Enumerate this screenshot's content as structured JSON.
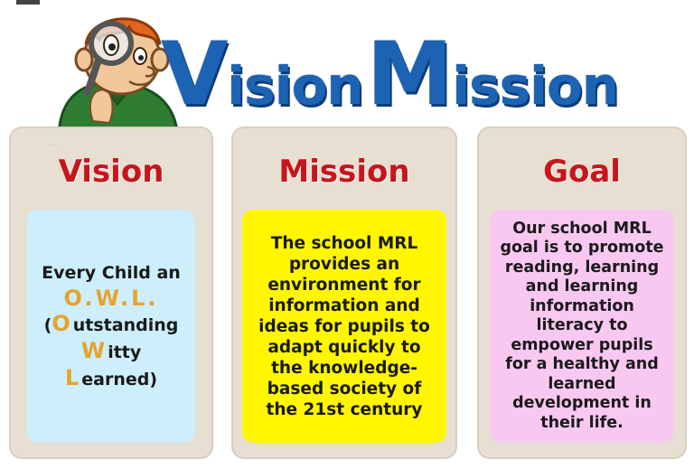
{
  "banner": {
    "title_part1_initial": "V",
    "title_part1_rest": "ision",
    "title_part2_initial": "M",
    "title_part2_rest": "ission"
  },
  "panels": {
    "vision": {
      "heading": "Vision",
      "line1": "Every Child an",
      "owl": "O.W.L.",
      "paren_open": "(",
      "o_letter": "O",
      "o_rest": "utstanding",
      "w_letter": "W",
      "w_rest": "itty",
      "l_letter": "L",
      "l_rest": "earned)"
    },
    "mission": {
      "heading": "Mission",
      "body": "The school MRL provides an environment for information and ideas for pupils to adapt quickly to the knowledge-based society of the 21st century"
    },
    "goal": {
      "heading": "Goal",
      "body": "Our school MRL goal is to promote reading, learning and learning information literacy to empower pupils for a healthy and learned development in their life."
    }
  },
  "colors": {
    "title_blue": "#1d63b4",
    "heading_red": "#c8141b",
    "owl_gold": "#e5a32d",
    "panel_bg": "#e7dfd2",
    "vision_card": "#cdeefb",
    "mission_card": "#fff600",
    "goal_card": "#f9c8f1"
  },
  "icons": {
    "mascot": "cartoon-boy-with-magnifying-glass"
  }
}
